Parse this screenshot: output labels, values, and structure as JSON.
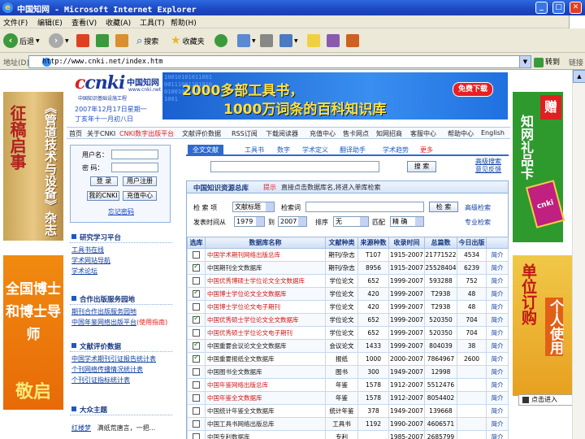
{
  "window": {
    "title": "中国知网 - Microsoft Internet Explorer"
  },
  "menu": [
    "文件(F)",
    "编辑(E)",
    "查看(V)",
    "收藏(A)",
    "工具(T)",
    "帮助(H)"
  ],
  "toolbar": {
    "back": "后退",
    "search": "搜索",
    "favorites": "收藏夹"
  },
  "address": {
    "label": "地址(D)",
    "url": "http://www.cnki.net/index.htm",
    "go": "转到",
    "links": "链接"
  },
  "logo": {
    "name": "cnki",
    "cn": "中国知网",
    "url": "www.cnki.net",
    "sub": "中国知识基础设施工程",
    "date": "2007年12月17日星期一",
    "lunar": "丁亥年十一月初八日"
  },
  "banner": {
    "line1": "2000多部工具书，",
    "line2": "1000万词条的百科知识库",
    "download": "免费下载",
    "binary": "1001010101100100111001101010010010110101001001"
  },
  "nav": [
    "首页",
    "关于CNKI",
    "CNKI数字出版平台",
    "文献评价数据",
    "RSS订阅",
    "下载阅读器",
    "充值中心",
    "售卡网点",
    "知网招商",
    "客服中心",
    "帮助中心",
    "English"
  ],
  "login": {
    "username": "用户名：",
    "password": "密  码：",
    "login": "登 录",
    "register": "用户注册",
    "my": "我的CNKI",
    "recharge": "充值中心",
    "forgot": "忘记密码"
  },
  "left_sections": [
    {
      "title": "研究学习平台",
      "items": [
        "工具书在线",
        "学术网站导航",
        "学术论坛"
      ]
    },
    {
      "title": "合作出版服务园地",
      "items": [
        "期刊合作出版服务园地",
        "中国年鉴网络出版平台"
      ],
      "note": "(使用指南)"
    },
    {
      "title": "文献评价数据",
      "items": [
        "中国学术期刊引证报告统计表",
        "个刊网络传播情况统计表",
        "个刊引证指标统计表"
      ]
    },
    {
      "title": "大众主题",
      "items": [
        "红楼梦",
        "满纸荒唐言，一把..."
      ]
    }
  ],
  "search": {
    "tabs": [
      "全文文献",
      "工具书",
      "数字",
      "学术定义",
      "翻译助手",
      "学术趋势",
      "更多"
    ],
    "button": "搜 索",
    "adv1": "高级搜索",
    "adv2": "意见反馈"
  },
  "db": {
    "title": "中国知识资源总库",
    "tip_label": "提示",
    "tip": "直接点击数据库名,将进入单库检索",
    "field_label": "检 索 项",
    "field_value": "文献标题",
    "word_label": "检索词",
    "search_btn": "检 索",
    "adv": "高级检索",
    "pro": "专业检索",
    "time_label": "发表时间从",
    "from": "1979",
    "to_label": "到",
    "to": "2007",
    "sort_label": "排序",
    "sort": "无",
    "match_label": "匹配",
    "match": "精 确",
    "headers": [
      "选库",
      "数据库名称",
      "文献种类",
      "来源种数",
      "收录时间",
      "总篇数",
      "今日出版",
      ""
    ],
    "rows": [
      {
        "checked": false,
        "red": true,
        "name": "中国学术期刊网络出版总库",
        "type": "期刊/杂志",
        "src": "T107",
        "time": "1915-2007",
        "total": "21771522",
        "today": "4534",
        "intro": "简介"
      },
      {
        "checked": true,
        "red": false,
        "name": "中国期刊全文数据库",
        "type": "期刊/杂志",
        "src": "8956",
        "time": "1915-2007",
        "total": "25528404",
        "today": "6239",
        "intro": "简介"
      },
      {
        "checked": false,
        "red": true,
        "name": "中国优秀博硕士学位论文全文数据库",
        "type": "学位论文",
        "src": "652",
        "time": "1999-2007",
        "total": "593288",
        "today": "752",
        "intro": "简介"
      },
      {
        "checked": true,
        "red": true,
        "name": "中国博士学位论文全文数据库",
        "type": "学位论文",
        "src": "420",
        "time": "1999-2007",
        "total": "T2938",
        "today": "48",
        "intro": "简介"
      },
      {
        "checked": false,
        "red": true,
        "name": "中国博士学位论文电子期刊",
        "type": "学位论文",
        "src": "420",
        "time": "1999-2007",
        "total": "T2938",
        "today": "48",
        "intro": "简介"
      },
      {
        "checked": true,
        "red": true,
        "name": "中国优秀硕士学位论文全文数据库",
        "type": "学位论文",
        "src": "652",
        "time": "1999-2007",
        "total": "520350",
        "today": "704",
        "intro": "简介"
      },
      {
        "checked": false,
        "red": true,
        "name": "中国优秀硕士学位论文电子期刊",
        "type": "学位论文",
        "src": "652",
        "time": "1999-2007",
        "total": "520350",
        "today": "704",
        "intro": "简介"
      },
      {
        "checked": true,
        "red": false,
        "name": "中国重要会议论文全文数据库",
        "type": "会议论文",
        "src": "1433",
        "time": "1999-2007",
        "total": "804039",
        "today": "38",
        "intro": "简介"
      },
      {
        "checked": true,
        "red": false,
        "name": "中国重要报纸全文数据库",
        "type": "报纸",
        "src": "1000",
        "time": "2000-2007",
        "total": "7864967",
        "today": "2600",
        "intro": "简介"
      },
      {
        "checked": false,
        "red": false,
        "name": "中国图书全文数据库",
        "type": "图书",
        "src": "300",
        "time": "1949-2007",
        "total": "12998",
        "today": "",
        "intro": "简介"
      },
      {
        "checked": false,
        "red": true,
        "name": "中国年鉴网络出版总库",
        "type": "年鉴",
        "src": "1578",
        "time": "1912-2007",
        "total": "5512476",
        "today": "",
        "intro": "简介"
      },
      {
        "checked": false,
        "red": true,
        "name": "中国年鉴全文数据库",
        "type": "年鉴",
        "src": "1578",
        "time": "1912-2007",
        "total": "8054402",
        "today": "",
        "intro": "简介"
      },
      {
        "checked": false,
        "red": false,
        "name": "中国统计年鉴全文数据库",
        "type": "统计年鉴",
        "src": "378",
        "time": "1949-2007",
        "total": "139668",
        "today": "",
        "intro": "简介"
      },
      {
        "checked": false,
        "red": false,
        "name": "中国工具书网络出版总库",
        "type": "工具书",
        "src": "1192",
        "time": "1990-2007",
        "total": "4606571",
        "today": "",
        "intro": "简介"
      },
      {
        "checked": false,
        "red": false,
        "name": "中国专利数据库",
        "type": "专利",
        "src": "",
        "time": "1985-2007",
        "total": "2685799",
        "today": "",
        "intro": "简介"
      }
    ]
  },
  "ads": {
    "left1_a": "征稿启事",
    "left1_b": "《管道技术与设备》杂志",
    "left2_a": "全国博士和博士导师",
    "left2_b": "敬启",
    "right1": "知网礼品卡",
    "right1_zeng": "赠",
    "right1_box": "cnki",
    "right2_a": "单位订购",
    "right2_b": "个人使用",
    "right2_btn": "点击进入"
  },
  "colors": {
    "title_bar": "#1c48c0",
    "brand_blue": "#1a3a9a",
    "accent_red": "#e02020",
    "chrome": "#ece9d8"
  }
}
